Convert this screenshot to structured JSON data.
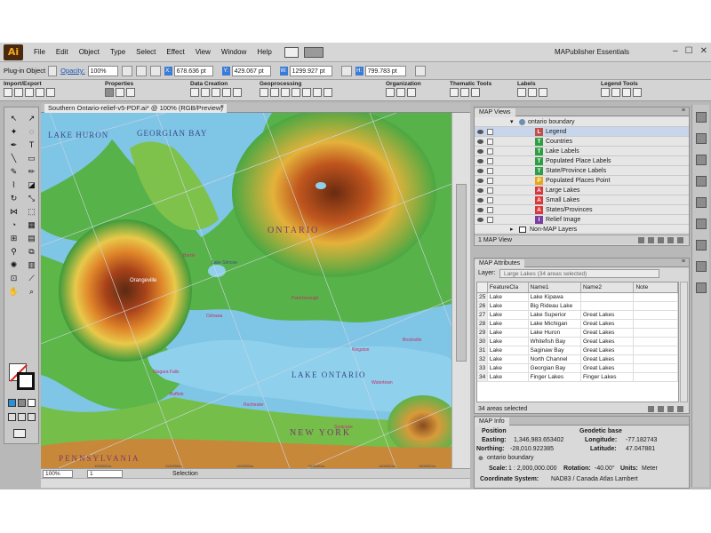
{
  "app": {
    "logo": "Ai",
    "workspace": "MAPublisher Essentials"
  },
  "menu": [
    "File",
    "Edit",
    "Object",
    "Type",
    "Select",
    "Effect",
    "View",
    "Window",
    "Help"
  ],
  "window_controls": [
    "–",
    "☐",
    "✕"
  ],
  "control_bar": {
    "object_type": "Plug-in Object",
    "opacity_label": "Opacity:",
    "opacity_value": "100%",
    "x_label": "X:",
    "x_value": "678.636 pt",
    "y_label": "Y:",
    "y_value": "429.067 pt",
    "w_label": "W:",
    "w_value": "1299.927 pt",
    "h_label": "H:",
    "h_value": "799.783 pt"
  },
  "mp_toolbar": {
    "groups": [
      "Import/Export",
      "Properties",
      "Data Creation",
      "Geoprocessing",
      "Organization",
      "Thematic Tools",
      "Labels",
      "Legend Tools"
    ]
  },
  "document": {
    "tab_title": "Southern Ontario-relief-v5-PDF.ai* @ 100% (RGB/Preview)",
    "tab_close": "×",
    "zoom": "100%",
    "page": "1",
    "status": "Selection"
  },
  "map_labels": {
    "lake_huron": "LAKE HURON",
    "georgian_bay": "GEORGIAN BAY",
    "ontario": "ONTARIO",
    "lake_ontario": "LAKE ONTARIO",
    "new_york": "NEW YORK",
    "pennsylvania": "PENNSYLVANIA",
    "lake_simcoe": "Lake Simcoe",
    "orangeville": "Orangeville",
    "barrie": "Barrie",
    "oshawa": "Oshawa",
    "kingston": "Kingston",
    "brockville": "Brockville",
    "niagara_falls": "Niagara Falls",
    "buffalo": "Buffalo",
    "rochester": "Rochester",
    "watertown": "Watertown",
    "syracuse": "Syracuse",
    "peterborough": "Peterborough",
    "ticks": [
      "1000000m.",
      "1100000m.",
      "1200000m.",
      "1300000m.",
      "1400000m.",
      "1500000m."
    ]
  },
  "map_views": {
    "tab": "MAP Views",
    "menu_icon": "≡",
    "root": "ontario boundary",
    "layers": [
      {
        "name": "Legend",
        "badge": "L",
        "color": "#c0504d"
      },
      {
        "name": "Countries",
        "badge": "T",
        "color": "#2f9e44"
      },
      {
        "name": "Lake Labels",
        "badge": "T",
        "color": "#2f9e44"
      },
      {
        "name": "Populated Place Labels",
        "badge": "T",
        "color": "#2f9e44"
      },
      {
        "name": "State/Province Labels",
        "badge": "T",
        "color": "#2f9e44"
      },
      {
        "name": "Populated Places Point",
        "badge": "P",
        "color": "#e6a817"
      },
      {
        "name": "Large Lakes",
        "badge": "A",
        "color": "#d9383a"
      },
      {
        "name": "Small Lakes",
        "badge": "A",
        "color": "#d9383a"
      },
      {
        "name": "States/Provinces",
        "badge": "A",
        "color": "#d9383a"
      },
      {
        "name": "Relief Image",
        "badge": "I",
        "color": "#7b3fa0"
      }
    ],
    "non_map": "Non-MAP Layers",
    "footer": "1 MAP View"
  },
  "map_attributes": {
    "tab": "MAP Attributes",
    "layer_label": "Layer:",
    "layer_value": "Large Lakes (34 areas selected)",
    "columns": [
      "FeatureCla",
      "Name1",
      "Name2",
      "Note"
    ],
    "rows": [
      [
        "25",
        "Lake",
        "Lake Kipawa",
        ""
      ],
      [
        "26",
        "Lake",
        "Big Rideau Lake",
        ""
      ],
      [
        "27",
        "Lake",
        "Lake Superior",
        "Great Lakes"
      ],
      [
        "28",
        "Lake",
        "Lake Michigan",
        "Great Lakes"
      ],
      [
        "29",
        "Lake",
        "Lake Huron",
        "Great Lakes"
      ],
      [
        "30",
        "Lake",
        "Whitefish Bay",
        "Great Lakes"
      ],
      [
        "31",
        "Lake",
        "Saginaw Bay",
        "Great Lakes"
      ],
      [
        "32",
        "Lake",
        "North Channel",
        "Great Lakes"
      ],
      [
        "33",
        "Lake",
        "Georgian Bay",
        "Great Lakes"
      ],
      [
        "34",
        "Lake",
        "Finger Lakes",
        "Finger Lakes"
      ]
    ],
    "footer": "34 areas selected"
  },
  "map_info": {
    "tab": "MAP Info",
    "position_title": "Position",
    "easting_label": "Easting:",
    "easting_value": "1,346,983.653402",
    "northing_label": "Northing:",
    "northing_value": "-28,010.922385",
    "boundary": "ontario boundary",
    "scale_label": "Scale:",
    "scale_value": "1 : 2,000,000.000",
    "geo_title": "Geodetic base",
    "longitude_label": "Longitude:",
    "longitude_value": "-77.182743",
    "latitude_label": "Latitude:",
    "latitude_value": "47.047881",
    "rotation_label": "Rotation:",
    "rotation_value": "-40.00°",
    "units_label": "Units:",
    "units_value": "Meter",
    "cs_label": "Coordinate System:",
    "cs_value": "NAD83 / Canada Atlas Lambert"
  }
}
